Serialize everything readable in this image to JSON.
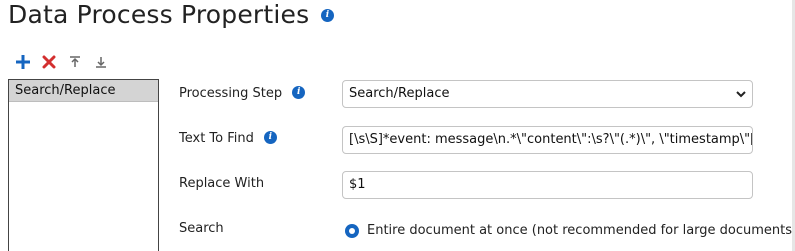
{
  "page": {
    "title": "Data Process Properties"
  },
  "icons": {
    "info": "info-icon",
    "add": "plus-icon",
    "remove": "x-icon",
    "move_up": "move-top-icon",
    "move_down": "move-bottom-icon"
  },
  "colors": {
    "accent": "#1565c0",
    "remove": "#d32f2f",
    "selected_item_bg": "#d4d4d4"
  },
  "steps_list": {
    "items": [
      {
        "label": "Search/Replace",
        "selected": true
      }
    ]
  },
  "form": {
    "processing_step": {
      "label": "Processing Step",
      "value": "Search/Replace",
      "options": [
        "Search/Replace"
      ]
    },
    "text_to_find": {
      "label": "Text To Find",
      "value": "[\\s\\S]*event: message\\n.*\\\"content\\\":\\s?\\\"(.*)\\\", \\\"timestamp\\\"[\\s\\S]*"
    },
    "replace_with": {
      "label": "Replace With",
      "value": "$1"
    },
    "search": {
      "label": "Search",
      "option_selected": "Entire document at once (not recommended for large documents)"
    }
  }
}
